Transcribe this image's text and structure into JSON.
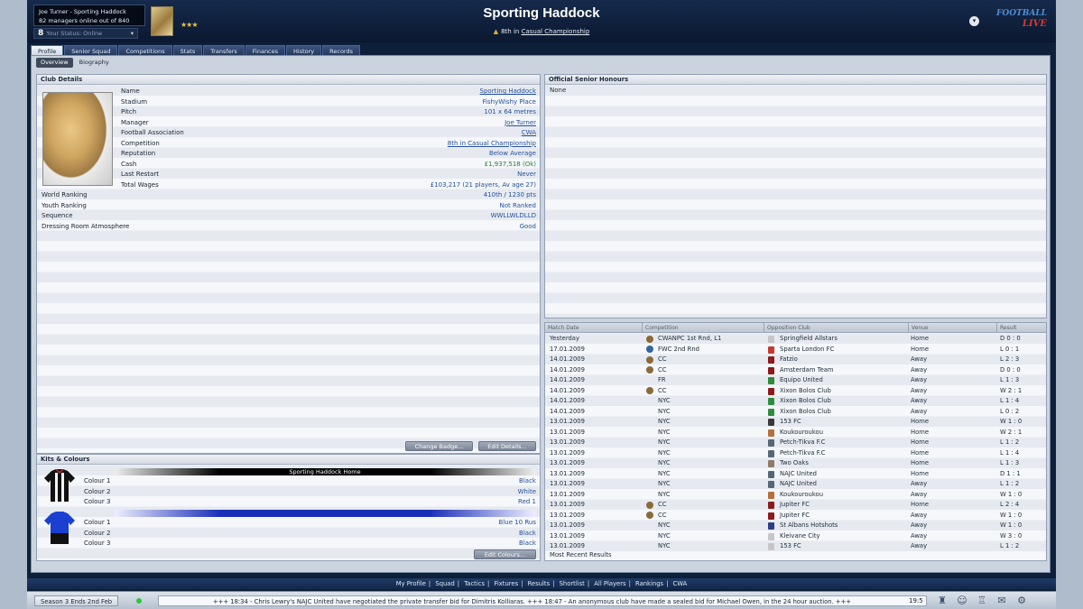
{
  "header": {
    "user_line": "Joe Turner - Sporting Haddock",
    "managers_online": "82 managers online out of 840",
    "online_count": "8",
    "online_status": "Your Status: Online",
    "stars": "★★★",
    "club_name": "Sporting Haddock",
    "position_prefix": "8th in",
    "position_league": "Casual Championship",
    "logo_line1": "FOOTBALL",
    "logo_line2": "LIVE"
  },
  "tabs": [
    "Profile",
    "Senior Squad",
    "Competitions",
    "Stats",
    "Transfers",
    "Finances",
    "History",
    "Records"
  ],
  "subtabs": [
    "Overview",
    "Biography"
  ],
  "club_details": {
    "title": "Club Details",
    "rows": [
      {
        "label": "Name",
        "value": "Sporting Haddock"
      },
      {
        "label": "Stadium",
        "value": "FishyWishy Place"
      },
      {
        "label": "Pitch",
        "value": "101 x 64 metres"
      },
      {
        "label": "Manager",
        "value": "Joe Turner"
      },
      {
        "label": "Football Association",
        "value": "CWA"
      },
      {
        "label": "Competition",
        "value": "8th in Casual Championship"
      },
      {
        "label": "Reputation",
        "value": "Below Average"
      },
      {
        "label": "Cash",
        "value": "£1,937,518 (Ok)"
      },
      {
        "label": "Last Restart",
        "value": "Never"
      },
      {
        "label": "Total Wages",
        "value": "£103,217 (21 players, Av age 27)"
      },
      {
        "label": "World Ranking",
        "value": "410th / 1230 pts"
      },
      {
        "label": "Youth Ranking",
        "value": "Not Ranked"
      },
      {
        "label": "Sequence",
        "value": "WWLLWLDLLD"
      },
      {
        "label": "Dressing Room Atmosphere",
        "value": "Good"
      }
    ],
    "change_badge": "Change Badge...",
    "edit_details": "Edit Details..."
  },
  "kits": {
    "title": "Kits & Colours",
    "home_name": "Sporting Haddock Home",
    "home_colours": [
      {
        "label": "Colour 1",
        "value": "Black"
      },
      {
        "label": "Colour 2",
        "value": "White"
      },
      {
        "label": "Colour 3",
        "value": "Red 1"
      }
    ],
    "away_colours": [
      {
        "label": "Colour 1",
        "value": "Blue 10 Rus"
      },
      {
        "label": "Colour 2",
        "value": "Black"
      },
      {
        "label": "Colour 3",
        "value": "Black"
      }
    ],
    "edit_colours": "Edit Colours..."
  },
  "honours": {
    "title": "Official Senior Honours",
    "none": "None"
  },
  "results": {
    "headers": [
      "Match Date",
      "Competition",
      "Opposition Club",
      "Venue",
      "Result"
    ],
    "rows": [
      {
        "date": "Yesterday",
        "comp": "CWANPC 1st Rnd, L1",
        "opp": "Springfield Allstars",
        "venue": "Home",
        "result": "D 0 : 0"
      },
      {
        "date": "17.01.2009",
        "comp": "FWC 2nd Rnd",
        "opp": "Sparta London FC",
        "venue": "Home",
        "result": "L 0 : 1"
      },
      {
        "date": "14.01.2009",
        "comp": "CC",
        "opp": "Fatzio",
        "venue": "Away",
        "result": "L 2 : 3"
      },
      {
        "date": "14.01.2009",
        "comp": "CC",
        "opp": "Amsterdam Team",
        "venue": "Away",
        "result": "D 0 : 0"
      },
      {
        "date": "14.01.2009",
        "comp": "FR",
        "opp": "Equipo United",
        "venue": "Away",
        "result": "L 1 : 3"
      },
      {
        "date": "14.01.2009",
        "comp": "CC",
        "opp": "Xixon Bolos Club",
        "venue": "Away",
        "result": "W 2 : 1"
      },
      {
        "date": "14.01.2009",
        "comp": "NYC",
        "opp": "Xixon Bolos Club",
        "venue": "Away",
        "result": "L 1 : 4"
      },
      {
        "date": "14.01.2009",
        "comp": "NYC",
        "opp": "Xixon Bolos Club",
        "venue": "Away",
        "result": "L 0 : 2"
      },
      {
        "date": "13.01.2009",
        "comp": "NYC",
        "opp": "153 FC",
        "venue": "Home",
        "result": "W 1 : 0"
      },
      {
        "date": "13.01.2009",
        "comp": "NYC",
        "opp": "Koukouroukou",
        "venue": "Home",
        "result": "W 2 : 1"
      },
      {
        "date": "13.01.2009",
        "comp": "NYC",
        "opp": "Petch-Tikva F.C",
        "venue": "Home",
        "result": "L 1 : 2"
      },
      {
        "date": "13.01.2009",
        "comp": "NYC",
        "opp": "Petch-Tikva F.C",
        "venue": "Home",
        "result": "L 1 : 4"
      },
      {
        "date": "13.01.2009",
        "comp": "NYC",
        "opp": "Two Oaks",
        "venue": "Home",
        "result": "L 1 : 3"
      },
      {
        "date": "13.01.2009",
        "comp": "NYC",
        "opp": "NAJC United",
        "venue": "Home",
        "result": "D 1 : 1"
      },
      {
        "date": "13.01.2009",
        "comp": "NYC",
        "opp": "NAJC United",
        "venue": "Away",
        "result": "L 1 : 2"
      },
      {
        "date": "13.01.2009",
        "comp": "NYC",
        "opp": "Koukouroukou",
        "venue": "Away",
        "result": "W 1 : 0"
      },
      {
        "date": "13.01.2009",
        "comp": "CC",
        "opp": "Jupiter FC",
        "venue": "Home",
        "result": "L 2 : 4"
      },
      {
        "date": "13.01.2009",
        "comp": "CC",
        "opp": "Jupiter FC",
        "venue": "Away",
        "result": "W 1 : 0"
      },
      {
        "date": "13.01.2009",
        "comp": "NYC",
        "opp": "St Albans Hotshots",
        "venue": "Away",
        "result": "W 1 : 0"
      },
      {
        "date": "13.01.2009",
        "comp": "NYC",
        "opp": "Kleivane City",
        "venue": "Away",
        "result": "W 3 : 0"
      },
      {
        "date": "13.01.2009",
        "comp": "NYC",
        "opp": "153 FC",
        "venue": "Away",
        "result": "L 1 : 2"
      }
    ],
    "footer": "Most Recent Results"
  },
  "bottom_nav": [
    "My Profile",
    "Squad",
    "Tactics",
    "Fixtures",
    "Results",
    "Shortlist",
    "All Players",
    "Rankings",
    "CWA"
  ],
  "status": {
    "season": "Season 3 Ends 2nd Feb",
    "ticker": "+++   18:34 - Chris Lewry's NAJC United have negotiated the private transfer bid for Dimitris Kolliaras.   +++   18:47 - An anonymous club have made a sealed bid for Michael Owen, in the 24 hour auction.   +++",
    "time": "19:5"
  }
}
